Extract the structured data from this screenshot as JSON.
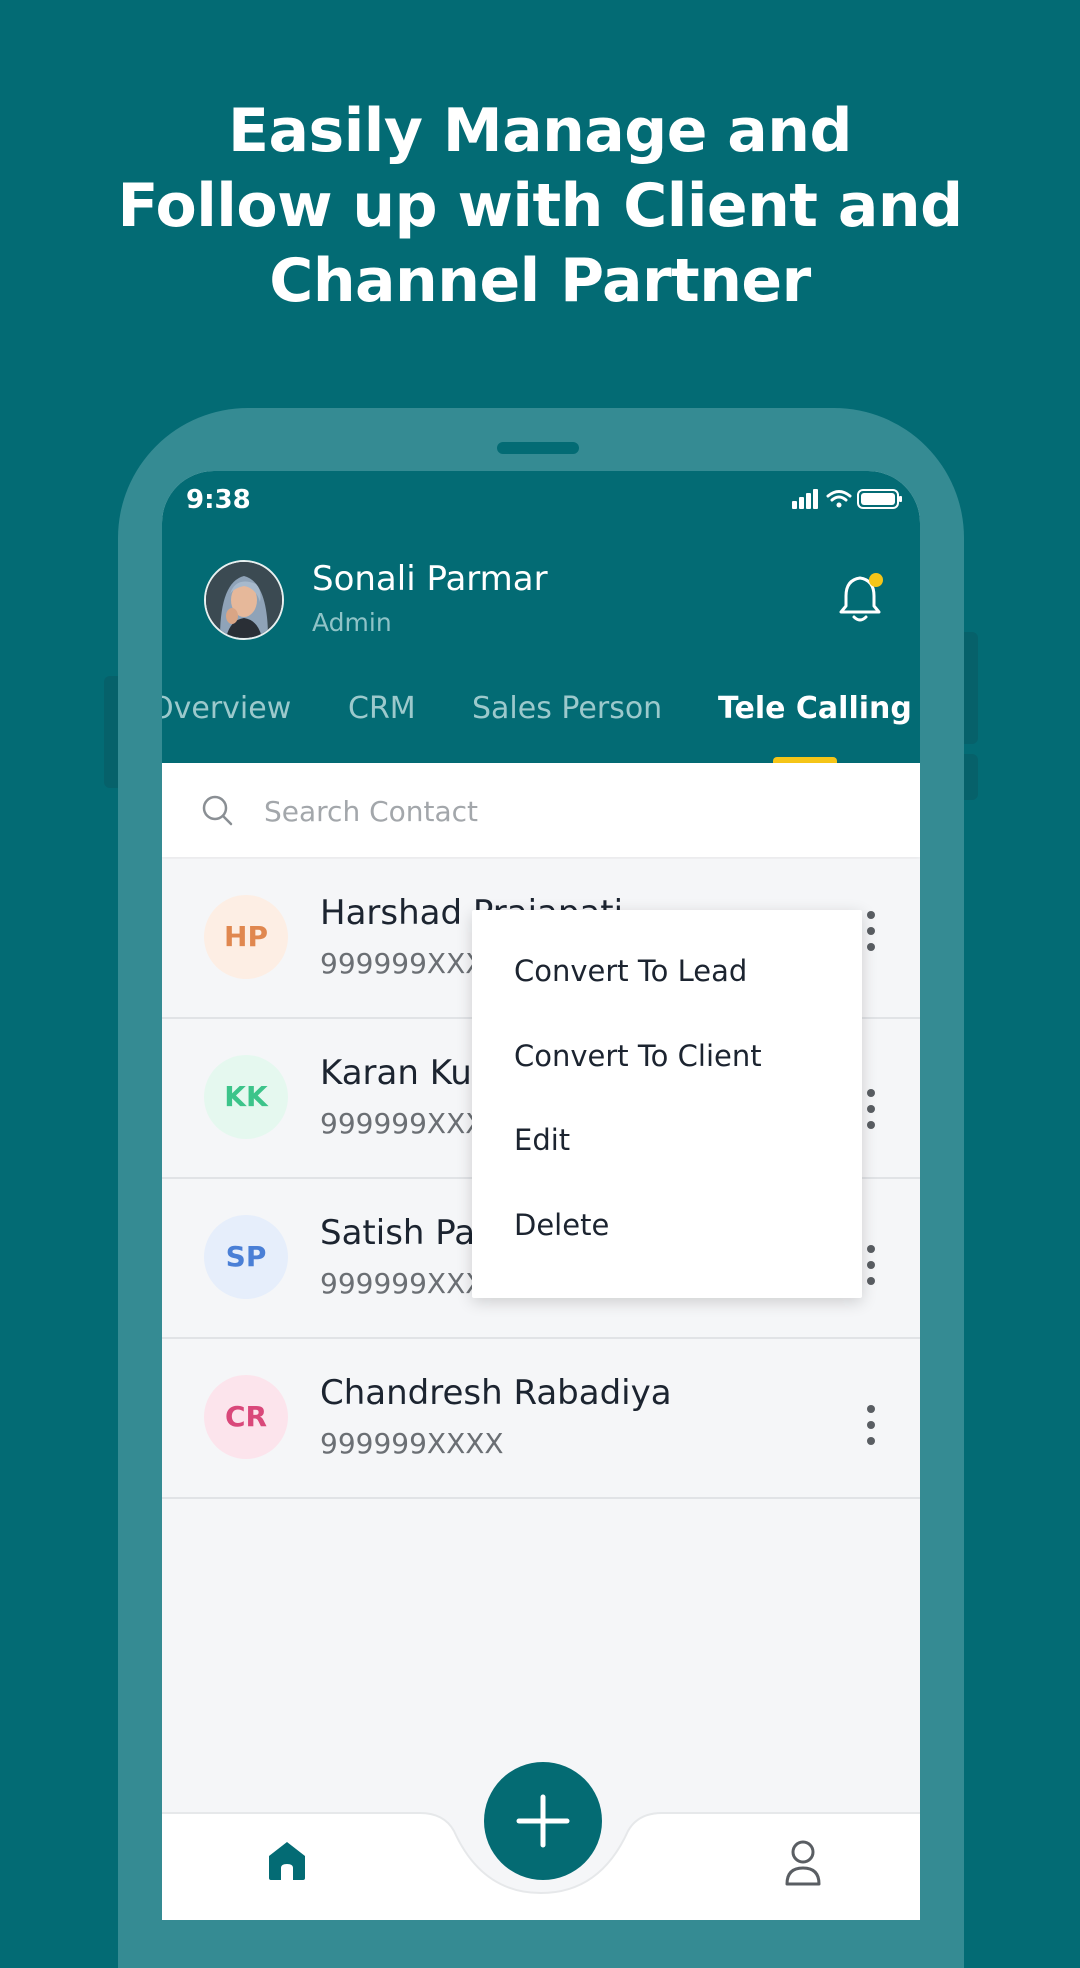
{
  "headline": {
    "line1": "Easily Manage and",
    "line2": "Follow up with Client and",
    "line3": "Channel Partner"
  },
  "status_bar": {
    "time": "9:38",
    "icons": [
      "signal-icon",
      "wifi-icon",
      "battery-icon"
    ]
  },
  "user": {
    "name": "Sonali Parmar",
    "role": "Admin"
  },
  "tabs": [
    {
      "label": "Overview",
      "active": false
    },
    {
      "label": "CRM",
      "active": false
    },
    {
      "label": "Sales Person",
      "active": false
    },
    {
      "label": "Tele Calling",
      "active": true
    }
  ],
  "search": {
    "placeholder": "Search Contact"
  },
  "contacts": [
    {
      "initials": "HP",
      "name": "Harshad Prajapati",
      "phone": "999999XXXX",
      "color": "#e0874f",
      "bg": "#fdeee4"
    },
    {
      "initials": "KK",
      "name": "Karan Kumar",
      "phone": "999999XXXX",
      "color": "#3cc48a",
      "bg": "#e5f8ef"
    },
    {
      "initials": "SP",
      "name": "Satish Patel",
      "phone": "999999XXXX",
      "color": "#4a7fd6",
      "bg": "#e6eefb"
    },
    {
      "initials": "CR",
      "name": "Chandresh Rabadiya",
      "phone": "999999XXXX",
      "color": "#d9487a",
      "bg": "#fce4ec"
    }
  ],
  "context_menu": {
    "items": [
      "Convert To Lead",
      "Convert To Client",
      "Edit",
      "Delete"
    ]
  },
  "colors": {
    "primary": "#036b74",
    "accent": "#f5c518",
    "frame": "#358b93",
    "notification_dot": "#f5c518"
  },
  "nav_icons": [
    "home-icon",
    "plus-icon",
    "profile-icon"
  ]
}
